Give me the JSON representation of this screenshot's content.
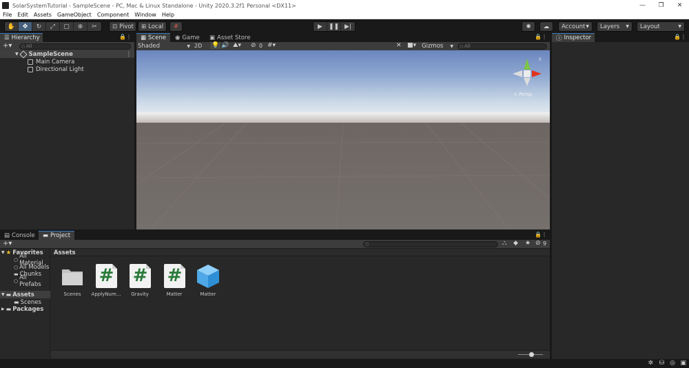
{
  "window": {
    "title": "SolarSystemTutorial - SampleScene - PC, Mac & Linux Standalone - Unity 2020.3.2f1 Personal <DX11>",
    "buttons": [
      "—",
      "❐",
      "✕"
    ]
  },
  "menu": [
    "File",
    "Edit",
    "Assets",
    "GameObject",
    "Component",
    "Window",
    "Help"
  ],
  "toolbar": {
    "pivot_label": "Pivot",
    "local_label": "Local",
    "account_label": "Account",
    "layers_label": "Layers",
    "layout_label": "Layout"
  },
  "hierarchy": {
    "tab_label": "Hierarchy",
    "search_placeholder": "All",
    "scene_name": "SampleScene",
    "objects": [
      "Main Camera",
      "Directional Light"
    ]
  },
  "scene": {
    "tabs": [
      "Scene",
      "Game",
      "Asset Store"
    ],
    "shading_mode": "Shaded",
    "mode_2d_label": "2D",
    "hidden_count": "0",
    "gizmos_label": "Gizmos",
    "search_placeholder": "All",
    "persp_label": "< Persp"
  },
  "inspector": {
    "tab_label": "Inspector"
  },
  "project": {
    "tabs": [
      "Console",
      "Project"
    ],
    "hidden_count": "9",
    "favorites_label": "Favorites",
    "favorites": [
      "All Material",
      "All Models",
      "Chunks",
      "All Prefabs"
    ],
    "assets_root_label": "Assets",
    "assets_children": [
      "Scenes"
    ],
    "packages_label": "Packages",
    "breadcrumb": "Assets",
    "items": [
      {
        "label": "Scenes",
        "icon": "folder-icon"
      },
      {
        "label": "ApplyNum...",
        "icon": "csharp-script-icon"
      },
      {
        "label": "Gravity",
        "icon": "csharp-script-icon"
      },
      {
        "label": "Matter",
        "icon": "csharp-script-icon"
      },
      {
        "label": "Matter",
        "icon": "prefab-cube-icon"
      }
    ]
  },
  "colors": {
    "accent": "#3a79bb",
    "script_green": "#2a7a3a",
    "prefab_blue": "#5ab2f0",
    "gizmo_red": "#e0341f",
    "gizmo_green": "#7ec34a"
  }
}
